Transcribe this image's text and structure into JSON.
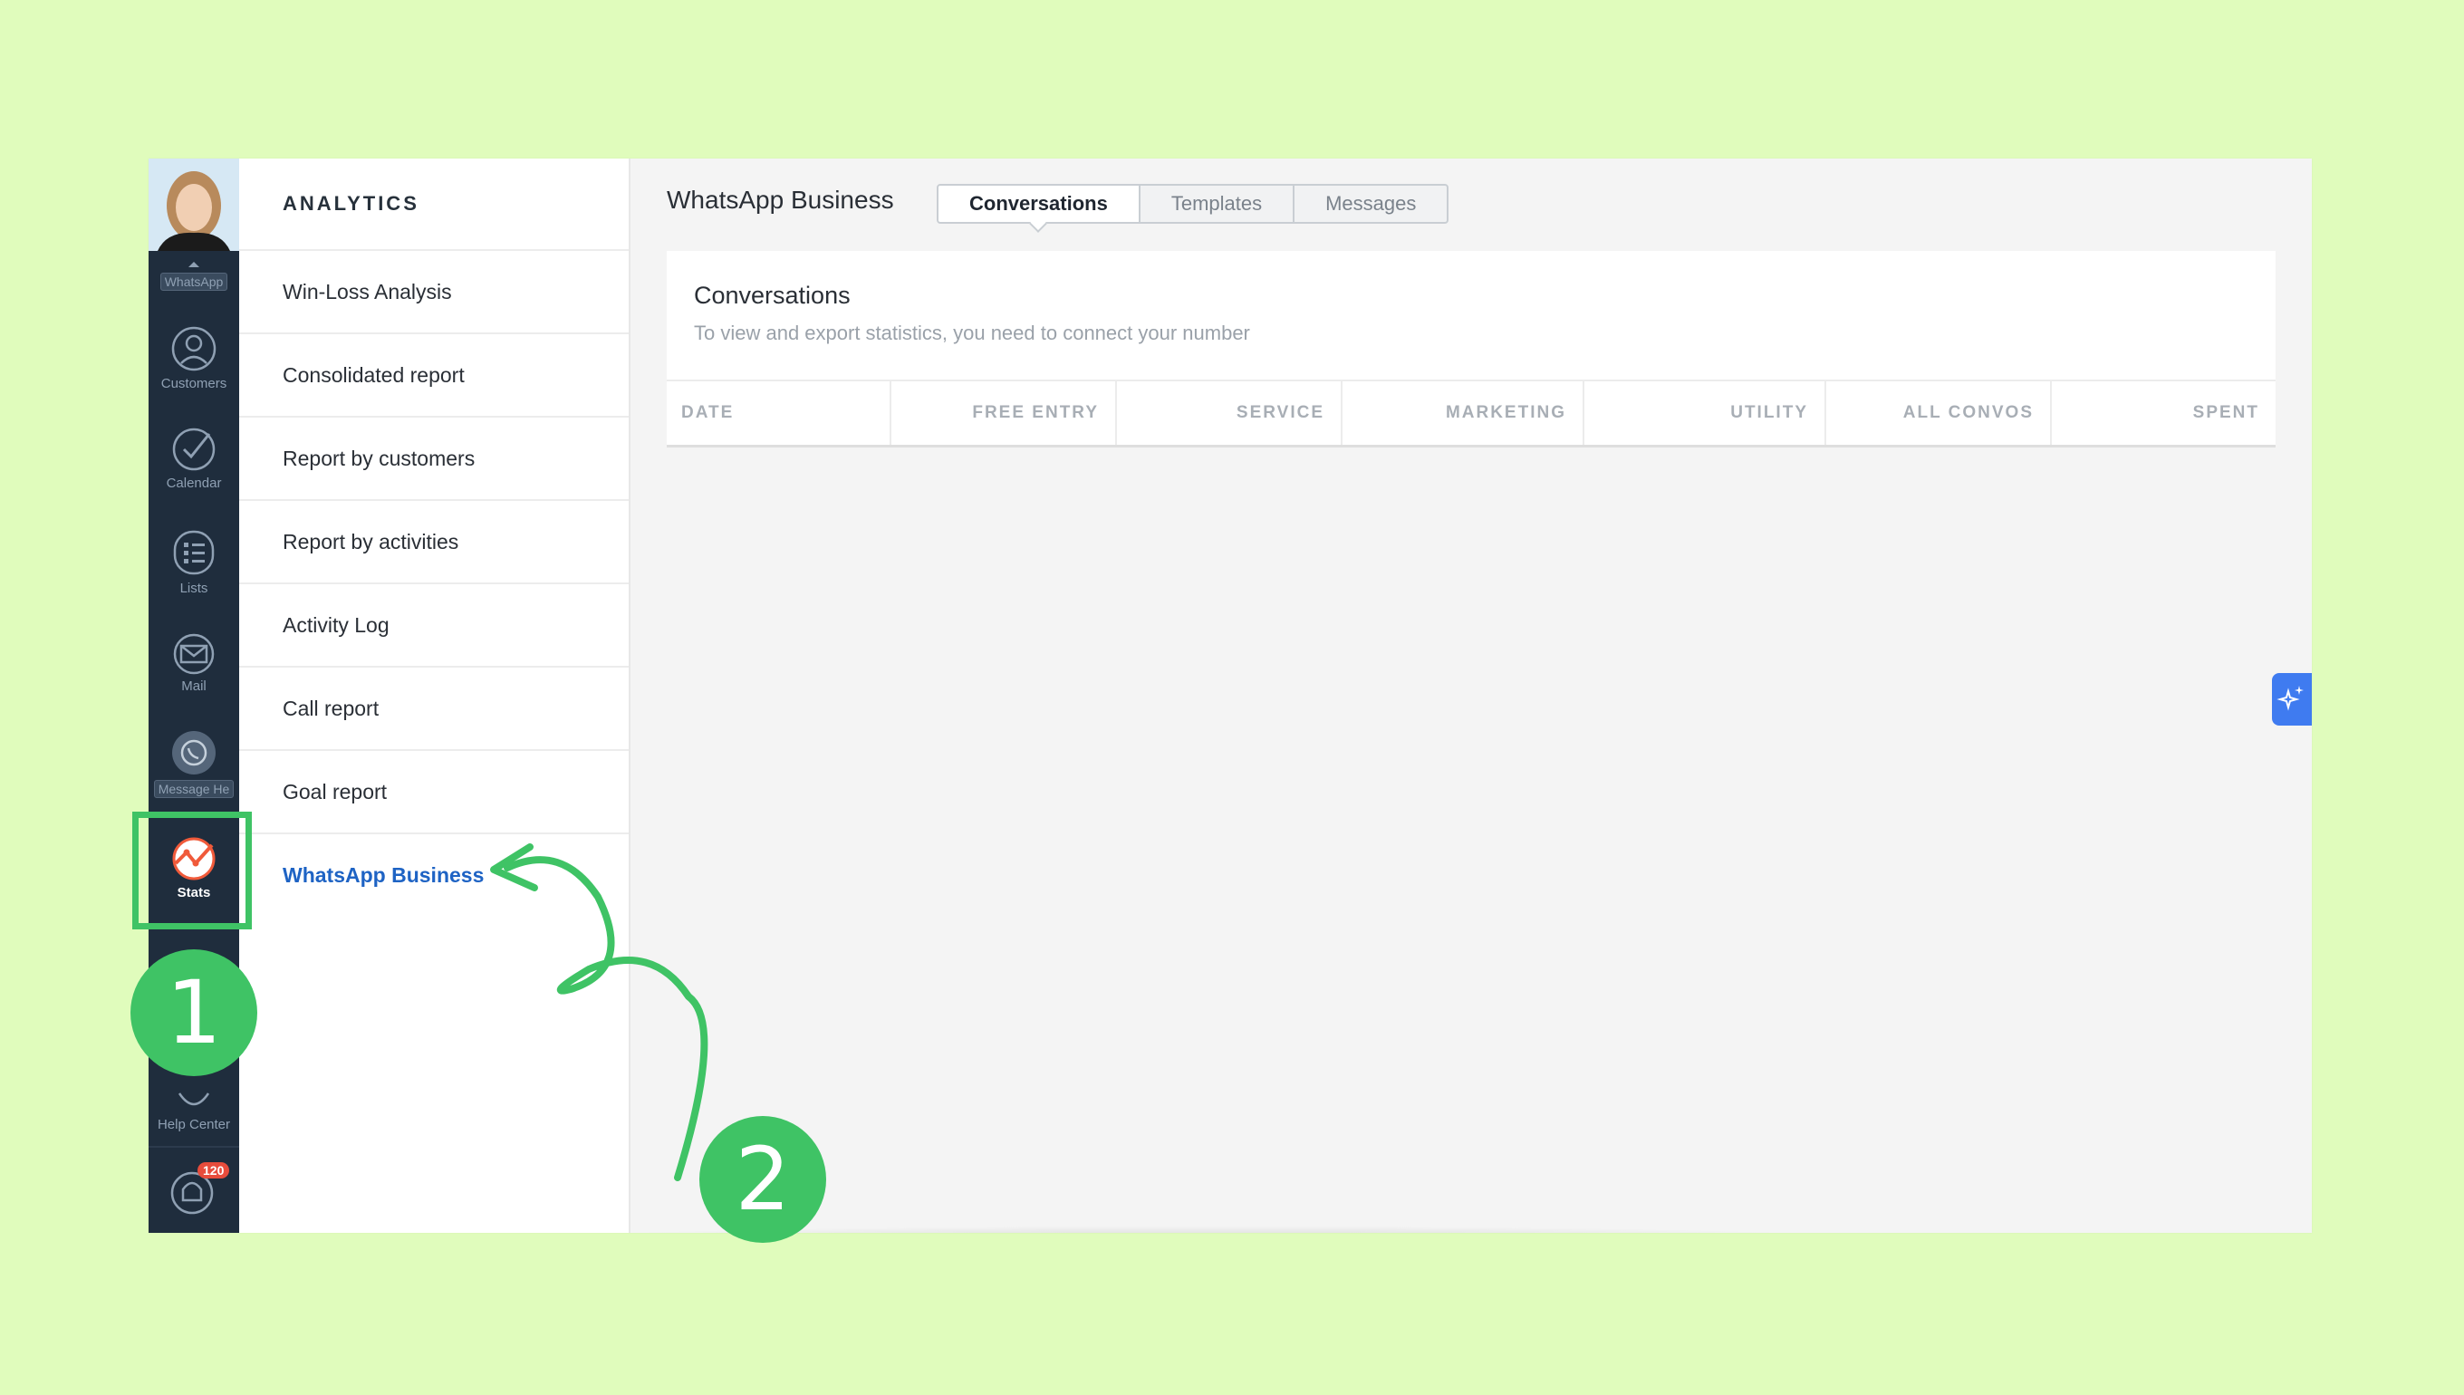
{
  "rail": {
    "top_pill": "WhatsApp",
    "items": [
      {
        "label": "Customers",
        "icon": "customers-icon"
      },
      {
        "label": "Calendar",
        "icon": "calendar-check-icon"
      },
      {
        "label": "Lists",
        "icon": "list-icon"
      },
      {
        "label": "Mail",
        "icon": "mail-icon"
      },
      {
        "label": "Message He",
        "icon": "whatsapp-icon"
      },
      {
        "label": "Stats",
        "icon": "stats-icon"
      },
      {
        "label": "Help Center",
        "icon": "help-icon"
      }
    ],
    "notification_count": "120"
  },
  "subnav": {
    "title": "ANALYTICS",
    "items": [
      "Win-Loss Analysis",
      "Consolidated report",
      "Report by customers",
      "Report by activities",
      "Activity Log",
      "Call report",
      "Goal report",
      "WhatsApp Business"
    ],
    "active_index": 7
  },
  "main": {
    "title": "WhatsApp Business",
    "tabs": [
      "Conversations",
      "Templates",
      "Messages"
    ],
    "active_tab": 0,
    "card": {
      "title": "Conversations",
      "subtitle": "To view and export statistics, you need to connect your number",
      "columns": [
        "DATE",
        "FREE ENTRY",
        "SERVICE",
        "MARKETING",
        "UTILITY",
        "ALL CONVOS",
        "SPENT"
      ]
    }
  },
  "annotations": {
    "step1": "1",
    "step2": "2"
  },
  "colors": {
    "background": "#e0fcbc",
    "rail": "#1f2d3d",
    "accent": "#1e63c4",
    "annotation": "#3fc365",
    "badge": "#e74c3c"
  }
}
